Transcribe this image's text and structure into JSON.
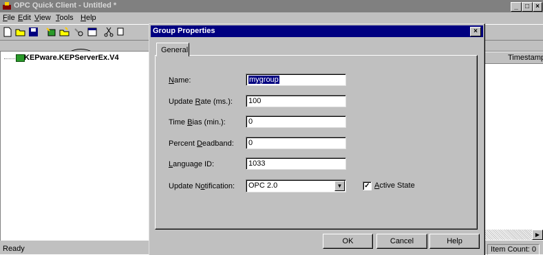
{
  "app": {
    "title": "OPC Quick Client - Untitled *",
    "menu": [
      "File",
      "Edit",
      "View",
      "Tools",
      "Help"
    ],
    "menu_underline": [
      "F",
      "E",
      "V",
      "T",
      "H"
    ]
  },
  "tree": {
    "root_label": "KEPware.KEPServerEx.V4"
  },
  "list": {
    "column_timestamp": "Timestamp"
  },
  "status": {
    "ready": "Ready",
    "item_count": "Item Count: 0"
  },
  "dialog": {
    "title": "Group Properties",
    "tab_general": "General",
    "fields": {
      "name_label_u": "N",
      "name_label_rest": "ame:",
      "name_value": "mygroup",
      "rate_label_a": "Update ",
      "rate_label_u": "R",
      "rate_label_b": "ate (ms.):",
      "rate_value": "100",
      "bias_label_a": "Time ",
      "bias_label_u": "B",
      "bias_label_b": "ias (min.):",
      "bias_value": "0",
      "dead_label_a": "Percent ",
      "dead_label_u": "D",
      "dead_label_b": "eadband:",
      "dead_value": "0",
      "lang_label_u": "L",
      "lang_label_rest": "anguage ID:",
      "lang_value": "1033",
      "notif_label_a": "Update N",
      "notif_label_u": "o",
      "notif_label_b": "tification:",
      "notif_value": "OPC 2.0",
      "active_u": "A",
      "active_rest": "ctive State",
      "active_checked": "✓"
    },
    "buttons": {
      "ok": "OK",
      "cancel": "Cancel",
      "help": "Help"
    }
  },
  "window_buttons": {
    "minimize": "_",
    "maximize": "□",
    "close": "×"
  }
}
